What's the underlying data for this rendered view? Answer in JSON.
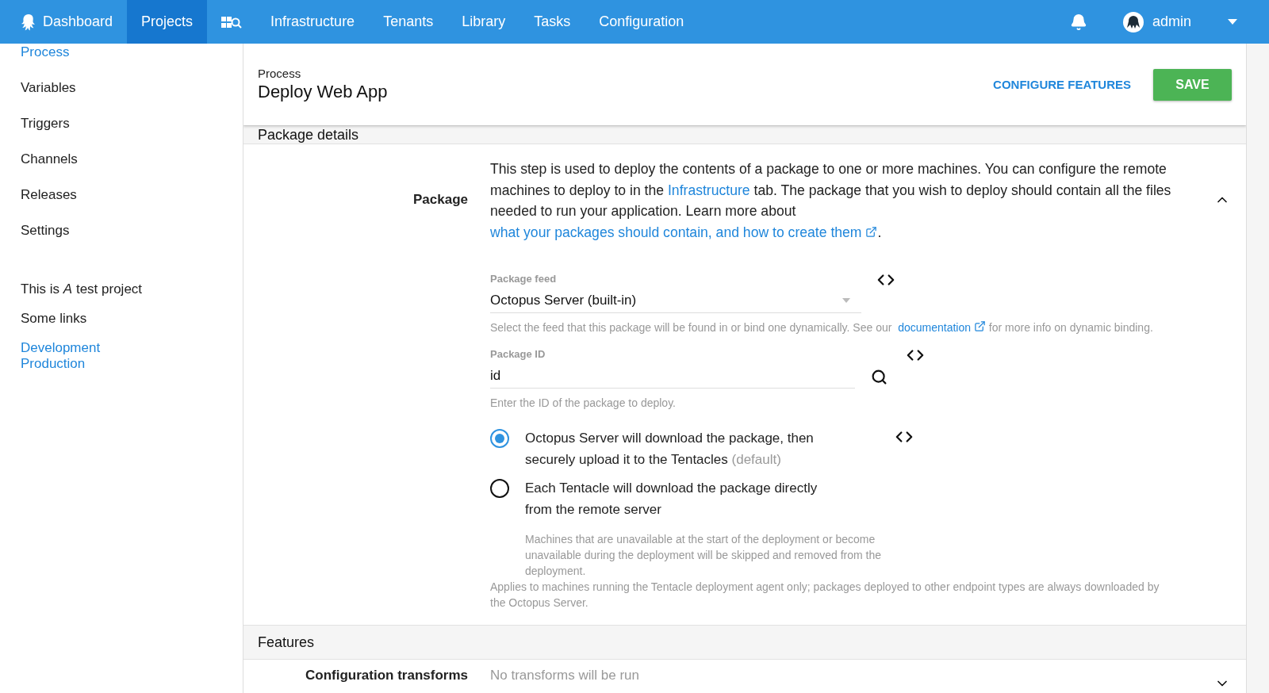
{
  "nav": {
    "items": [
      {
        "kind": "logo-link",
        "label": "Dashboard",
        "selected": false
      },
      {
        "kind": "link",
        "label": "Projects",
        "selected": true
      },
      {
        "kind": "search-link",
        "selected": false
      },
      {
        "kind": "link",
        "label": "Infrastructure",
        "selected": false
      },
      {
        "kind": "link",
        "label": "Tenants",
        "selected": false
      },
      {
        "kind": "link",
        "label": "Library",
        "selected": false
      },
      {
        "kind": "link",
        "label": "Tasks",
        "selected": false
      },
      {
        "kind": "link",
        "label": "Configuration",
        "selected": false
      }
    ],
    "user": {
      "name": "admin"
    }
  },
  "sidebar": {
    "items": [
      {
        "label": "Process",
        "selected": true
      },
      {
        "label": "Variables",
        "selected": false
      },
      {
        "label": "Triggers",
        "selected": false
      },
      {
        "label": "Channels",
        "selected": false
      },
      {
        "label": "Releases",
        "selected": false
      },
      {
        "label": "Settings",
        "selected": false
      }
    ],
    "description": "This is *A* test project",
    "links_title": "Some links",
    "links": [
      "Development",
      "Production"
    ]
  },
  "header": {
    "breadcrumb": "Process",
    "title": "Deploy Web App",
    "configure": "CONFIGURE FEATURES",
    "save": "SAVE"
  },
  "package_details": {
    "title": "Package details",
    "label": "Package",
    "expanded": true,
    "description": [
      {
        "kind": "text",
        "text": "This step is used to deploy the contents of a package to one or more machines. You can configure the remote machines to deploy to in the "
      },
      {
        "kind": "link",
        "text": "Infrastructure"
      },
      {
        "kind": "text",
        "text": " tab. The package that you wish to deploy should contain all the files needed to run your application. Learn more about "
      },
      {
        "kind": "link",
        "text": "what your packages should contain, and how"
      },
      {
        "kind": "external-link",
        "text": "to create them"
      },
      {
        "kind": "text",
        "text": "."
      }
    ],
    "feed": {
      "label": "Package feed",
      "value": "Octopus Server (built-in)",
      "help": [
        {
          "kind": "text",
          "text": "Select the feed that this package will be found in or bind one dynamically. See our "
        },
        {
          "kind": "external-link",
          "text": "documentation"
        },
        {
          "kind": "text",
          "text": " for more info on dynamic binding."
        }
      ]
    },
    "package_id": {
      "label": "Package ID",
      "value": "id",
      "help": "Enter the ID of the package to deploy."
    },
    "options": [
      {
        "label": "Octopus Server will download the package, then securely upload it to the Tentacles",
        "note": "(default)",
        "selected": true
      },
      {
        "label": "Each Tentacle will download the package directly from the remote server",
        "help": "Machines that are unavailable at the start of the deployment or become unavailable during the deployment will be skipped and removed from the deployment.",
        "selected": false
      }
    ],
    "note": "Applies to machines running the Tentacle deployment agent only; packages deployed to other endpoint types are always downloaded by the Octopus Server."
  },
  "features": {
    "title": "Features",
    "rows": [
      {
        "label": "Configuration transforms",
        "summary": "No transforms will be run",
        "expanded": false
      }
    ]
  }
}
